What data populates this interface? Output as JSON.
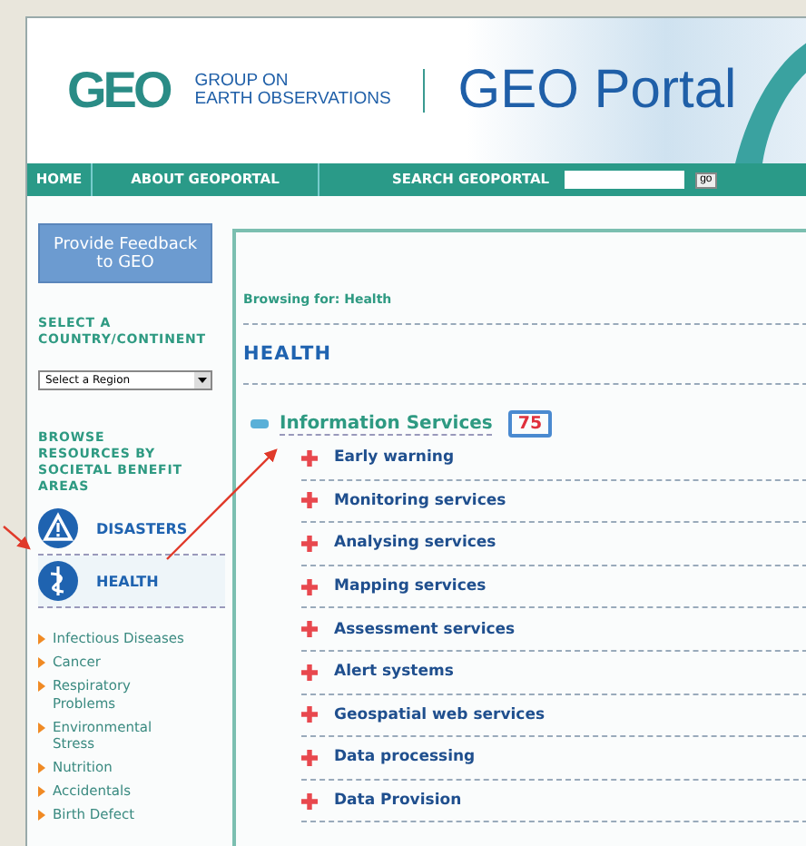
{
  "header": {
    "logo": {
      "mark": "GEO",
      "line_1": "GROUP ON",
      "line_2": "EARTH OBSERVATIONS"
    },
    "title": "GEO Portal"
  },
  "nav": {
    "items": [
      "HOME",
      "ABOUT GEOPORTAL"
    ],
    "search_label": "SEARCH GEOPORTAL",
    "search_button": "go"
  },
  "sidebar": {
    "feedback_button": "Provide Feedback to GEO",
    "region_label": "SELECT A COUNTRY/CONTINENT",
    "region_select": "Select a Region",
    "browse_label": "BROWSE RESOURCES BY SOCIETAL BENEFIT AREAS",
    "areas": [
      {
        "label": "DISASTERS",
        "kind": "disasters",
        "selected": false
      },
      {
        "label": "HEALTH",
        "kind": "health",
        "selected": true
      }
    ],
    "subtopics": [
      "Infectious Diseases",
      "Cancer",
      "Respiratory Problems",
      "Environmental Stress",
      "Nutrition",
      "Accidentals",
      "Birth Defect"
    ]
  },
  "main": {
    "breadcrumb": "Browsing for: Health",
    "heading": "HEALTH",
    "category": {
      "label": "Information Services",
      "count": "75",
      "expanded": true,
      "items": [
        {
          "label": "Early warning",
          "expanded": false
        },
        {
          "label": "Monitoring services",
          "expanded": false
        },
        {
          "label": "Analysing services",
          "expanded": false
        },
        {
          "label": "Mapping services",
          "expanded": false
        },
        {
          "label": "Assessment services",
          "expanded": false
        },
        {
          "label": "Alert systems",
          "expanded": false
        },
        {
          "label": "Geospatial web services",
          "expanded": false
        },
        {
          "label": "Data processing",
          "expanded": false
        },
        {
          "label": "Data Provision",
          "expanded": false
        }
      ]
    }
  }
}
